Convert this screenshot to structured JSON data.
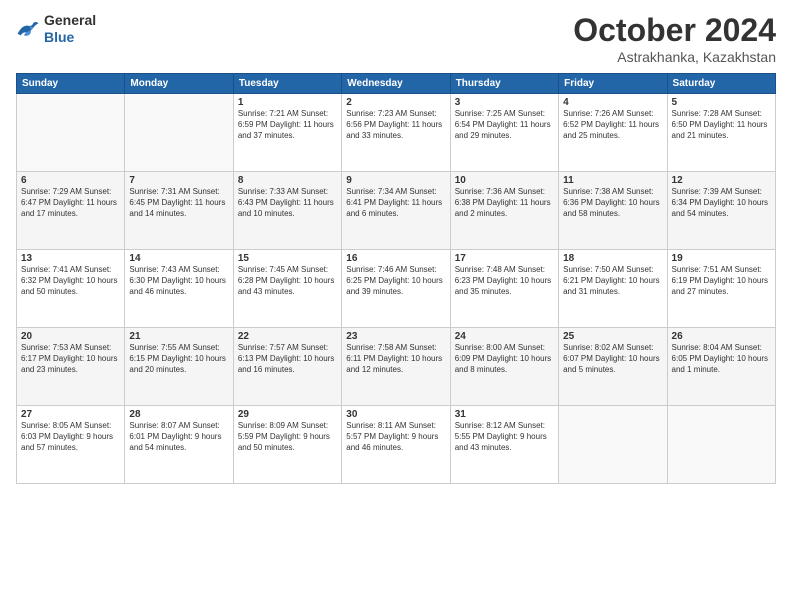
{
  "header": {
    "logo_general": "General",
    "logo_blue": "Blue",
    "month_title": "October 2024",
    "location": "Astrakhanka, Kazakhstan"
  },
  "days_of_week": [
    "Sunday",
    "Monday",
    "Tuesday",
    "Wednesday",
    "Thursday",
    "Friday",
    "Saturday"
  ],
  "weeks": [
    [
      {
        "num": "",
        "detail": ""
      },
      {
        "num": "",
        "detail": ""
      },
      {
        "num": "1",
        "detail": "Sunrise: 7:21 AM\nSunset: 6:59 PM\nDaylight: 11 hours\nand 37 minutes."
      },
      {
        "num": "2",
        "detail": "Sunrise: 7:23 AM\nSunset: 6:56 PM\nDaylight: 11 hours\nand 33 minutes."
      },
      {
        "num": "3",
        "detail": "Sunrise: 7:25 AM\nSunset: 6:54 PM\nDaylight: 11 hours\nand 29 minutes."
      },
      {
        "num": "4",
        "detail": "Sunrise: 7:26 AM\nSunset: 6:52 PM\nDaylight: 11 hours\nand 25 minutes."
      },
      {
        "num": "5",
        "detail": "Sunrise: 7:28 AM\nSunset: 6:50 PM\nDaylight: 11 hours\nand 21 minutes."
      }
    ],
    [
      {
        "num": "6",
        "detail": "Sunrise: 7:29 AM\nSunset: 6:47 PM\nDaylight: 11 hours\nand 17 minutes."
      },
      {
        "num": "7",
        "detail": "Sunrise: 7:31 AM\nSunset: 6:45 PM\nDaylight: 11 hours\nand 14 minutes."
      },
      {
        "num": "8",
        "detail": "Sunrise: 7:33 AM\nSunset: 6:43 PM\nDaylight: 11 hours\nand 10 minutes."
      },
      {
        "num": "9",
        "detail": "Sunrise: 7:34 AM\nSunset: 6:41 PM\nDaylight: 11 hours\nand 6 minutes."
      },
      {
        "num": "10",
        "detail": "Sunrise: 7:36 AM\nSunset: 6:38 PM\nDaylight: 11 hours\nand 2 minutes."
      },
      {
        "num": "11",
        "detail": "Sunrise: 7:38 AM\nSunset: 6:36 PM\nDaylight: 10 hours\nand 58 minutes."
      },
      {
        "num": "12",
        "detail": "Sunrise: 7:39 AM\nSunset: 6:34 PM\nDaylight: 10 hours\nand 54 minutes."
      }
    ],
    [
      {
        "num": "13",
        "detail": "Sunrise: 7:41 AM\nSunset: 6:32 PM\nDaylight: 10 hours\nand 50 minutes."
      },
      {
        "num": "14",
        "detail": "Sunrise: 7:43 AM\nSunset: 6:30 PM\nDaylight: 10 hours\nand 46 minutes."
      },
      {
        "num": "15",
        "detail": "Sunrise: 7:45 AM\nSunset: 6:28 PM\nDaylight: 10 hours\nand 43 minutes."
      },
      {
        "num": "16",
        "detail": "Sunrise: 7:46 AM\nSunset: 6:25 PM\nDaylight: 10 hours\nand 39 minutes."
      },
      {
        "num": "17",
        "detail": "Sunrise: 7:48 AM\nSunset: 6:23 PM\nDaylight: 10 hours\nand 35 minutes."
      },
      {
        "num": "18",
        "detail": "Sunrise: 7:50 AM\nSunset: 6:21 PM\nDaylight: 10 hours\nand 31 minutes."
      },
      {
        "num": "19",
        "detail": "Sunrise: 7:51 AM\nSunset: 6:19 PM\nDaylight: 10 hours\nand 27 minutes."
      }
    ],
    [
      {
        "num": "20",
        "detail": "Sunrise: 7:53 AM\nSunset: 6:17 PM\nDaylight: 10 hours\nand 23 minutes."
      },
      {
        "num": "21",
        "detail": "Sunrise: 7:55 AM\nSunset: 6:15 PM\nDaylight: 10 hours\nand 20 minutes."
      },
      {
        "num": "22",
        "detail": "Sunrise: 7:57 AM\nSunset: 6:13 PM\nDaylight: 10 hours\nand 16 minutes."
      },
      {
        "num": "23",
        "detail": "Sunrise: 7:58 AM\nSunset: 6:11 PM\nDaylight: 10 hours\nand 12 minutes."
      },
      {
        "num": "24",
        "detail": "Sunrise: 8:00 AM\nSunset: 6:09 PM\nDaylight: 10 hours\nand 8 minutes."
      },
      {
        "num": "25",
        "detail": "Sunrise: 8:02 AM\nSunset: 6:07 PM\nDaylight: 10 hours\nand 5 minutes."
      },
      {
        "num": "26",
        "detail": "Sunrise: 8:04 AM\nSunset: 6:05 PM\nDaylight: 10 hours\nand 1 minute."
      }
    ],
    [
      {
        "num": "27",
        "detail": "Sunrise: 8:05 AM\nSunset: 6:03 PM\nDaylight: 9 hours\nand 57 minutes."
      },
      {
        "num": "28",
        "detail": "Sunrise: 8:07 AM\nSunset: 6:01 PM\nDaylight: 9 hours\nand 54 minutes."
      },
      {
        "num": "29",
        "detail": "Sunrise: 8:09 AM\nSunset: 5:59 PM\nDaylight: 9 hours\nand 50 minutes."
      },
      {
        "num": "30",
        "detail": "Sunrise: 8:11 AM\nSunset: 5:57 PM\nDaylight: 9 hours\nand 46 minutes."
      },
      {
        "num": "31",
        "detail": "Sunrise: 8:12 AM\nSunset: 5:55 PM\nDaylight: 9 hours\nand 43 minutes."
      },
      {
        "num": "",
        "detail": ""
      },
      {
        "num": "",
        "detail": ""
      }
    ]
  ]
}
